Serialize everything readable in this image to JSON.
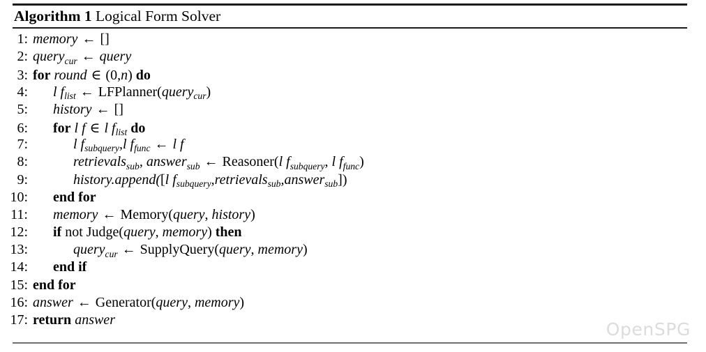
{
  "figure": {
    "kind": "algorithm-pseudocode",
    "title": {
      "keyword": "Algorithm",
      "number": "1",
      "caption": "Logical Form Solver"
    },
    "watermark": "OpenSPG",
    "rule_color": "#1a1a1a",
    "bottom_rule_color": "#6e6e6e",
    "watermark_color": "#dcdcdc"
  },
  "symbols": {
    "assign": "←",
    "member": "∈",
    "lbracket": "[",
    "rbracket": "]",
    "empty_list": "[]"
  },
  "lines": [
    {
      "n": "1:",
      "indent": 0,
      "plain": "memory ← []"
    },
    {
      "n": "2:",
      "indent": 0,
      "plain": "query_cur ← query"
    },
    {
      "n": "3:",
      "indent": 0,
      "plain": "for round ∈ (0,n) do"
    },
    {
      "n": "4:",
      "indent": 1,
      "plain": "lf_list ← LFPlanner(query_cur)"
    },
    {
      "n": "5:",
      "indent": 1,
      "plain": "history ← []"
    },
    {
      "n": "6:",
      "indent": 1,
      "plain": "for lf ∈ lf_list do"
    },
    {
      "n": "7:",
      "indent": 2,
      "plain": "lf_subquery, lf_func ← lf"
    },
    {
      "n": "8:",
      "indent": 2,
      "plain": "retrievals_sub, answer_sub ← Reasoner(lf_subquery, lf_func)"
    },
    {
      "n": "9:",
      "indent": 2,
      "plain": "history.append([lf_subquery, retrievals_sub, answer_sub])"
    },
    {
      "n": "10:",
      "indent": 1,
      "plain": "end for"
    },
    {
      "n": "11:",
      "indent": 1,
      "plain": "memory ← Memory(query, history)"
    },
    {
      "n": "12:",
      "indent": 1,
      "plain": "if not Judge(query, memory) then"
    },
    {
      "n": "13:",
      "indent": 2,
      "plain": "query_cur ← SupplyQuery(query, memory)"
    },
    {
      "n": "14:",
      "indent": 1,
      "plain": "end if"
    },
    {
      "n": "15:",
      "indent": 0,
      "plain": "end for"
    },
    {
      "n": "16:",
      "indent": 0,
      "plain": "answer ← Generator(query, memory)"
    },
    {
      "n": "17:",
      "indent": 0,
      "plain": "return answer"
    }
  ],
  "tokens": {
    "l1": [
      {
        "t": "memory",
        "s": "v"
      },
      {
        "t": " ← ",
        "s": "op"
      },
      {
        "t": "[]",
        "s": "f"
      }
    ],
    "l2": [
      {
        "t": "query",
        "s": "v",
        "sub": "cur"
      },
      {
        "t": " ← ",
        "s": "op"
      },
      {
        "t": "query",
        "s": "v"
      }
    ],
    "l3": [
      {
        "t": "for",
        "s": "b"
      },
      {
        "t": " ",
        "s": "f"
      },
      {
        "t": "round",
        "s": "v"
      },
      {
        "t": " ∈ ",
        "s": "op"
      },
      {
        "t": "(0,",
        "s": "f"
      },
      {
        "t": "n",
        "s": "v"
      },
      {
        "t": ") ",
        "s": "f"
      },
      {
        "t": "do",
        "s": "b"
      }
    ],
    "l4": [
      {
        "t": "l f",
        "s": "v",
        "sub": "list"
      },
      {
        "t": " ← ",
        "s": "op"
      },
      {
        "t": "LFPlanner(",
        "s": "f"
      },
      {
        "t": "query",
        "s": "v",
        "sub": "cur"
      },
      {
        "t": ")",
        "s": "f"
      }
    ],
    "l5": [
      {
        "t": "history",
        "s": "v"
      },
      {
        "t": " ← ",
        "s": "op"
      },
      {
        "t": "[]",
        "s": "f"
      }
    ],
    "l6": [
      {
        "t": "for",
        "s": "b"
      },
      {
        "t": " ",
        "s": "f"
      },
      {
        "t": "l f",
        "s": "v"
      },
      {
        "t": " ∈ ",
        "s": "op"
      },
      {
        "t": "l f",
        "s": "v",
        "sub": "list"
      },
      {
        "t": " ",
        "s": "f"
      },
      {
        "t": "do",
        "s": "b"
      }
    ],
    "l7": [
      {
        "t": "l f",
        "s": "v",
        "sub": "subquery"
      },
      {
        "t": ",",
        "s": "v"
      },
      {
        "t": "l f",
        "s": "v",
        "sub": "func"
      },
      {
        "t": " ← ",
        "s": "op"
      },
      {
        "t": "l f",
        "s": "v"
      }
    ],
    "l8": [
      {
        "t": "retrievals",
        "s": "v",
        "sub": "sub"
      },
      {
        "t": ", ",
        "s": "v"
      },
      {
        "t": "answer",
        "s": "v",
        "sub": "sub"
      },
      {
        "t": " ← ",
        "s": "op"
      },
      {
        "t": "Reasoner(",
        "s": "f"
      },
      {
        "t": "l f",
        "s": "v",
        "sub": "subquery"
      },
      {
        "t": ", ",
        "s": "f"
      },
      {
        "t": "l f",
        "s": "v",
        "sub": "func"
      },
      {
        "t": ")",
        "s": "f"
      }
    ],
    "l9": [
      {
        "t": "history.append(",
        "s": "v"
      },
      {
        "t": "[",
        "s": "f"
      },
      {
        "t": "l f",
        "s": "v",
        "sub": "subquery"
      },
      {
        "t": ",",
        "s": "v"
      },
      {
        "t": "retrievals",
        "s": "v",
        "sub": "sub"
      },
      {
        "t": ",",
        "s": "v"
      },
      {
        "t": "answer",
        "s": "v",
        "sub": "sub"
      },
      {
        "t": "]",
        "s": "f"
      },
      {
        "t": ")",
        "s": "f"
      }
    ],
    "l10": [
      {
        "t": "end for",
        "s": "b"
      }
    ],
    "l11": [
      {
        "t": "memory",
        "s": "v"
      },
      {
        "t": " ← ",
        "s": "op"
      },
      {
        "t": "Memory(",
        "s": "f"
      },
      {
        "t": "query",
        "s": "v"
      },
      {
        "t": ", ",
        "s": "f"
      },
      {
        "t": "history",
        "s": "v"
      },
      {
        "t": ")",
        "s": "f"
      }
    ],
    "l12": [
      {
        "t": "if",
        "s": "b"
      },
      {
        "t": " not Judge(",
        "s": "f"
      },
      {
        "t": "query",
        "s": "v"
      },
      {
        "t": ", ",
        "s": "f"
      },
      {
        "t": "memory",
        "s": "v"
      },
      {
        "t": ") ",
        "s": "f"
      },
      {
        "t": "then",
        "s": "b"
      }
    ],
    "l13": [
      {
        "t": "query",
        "s": "v",
        "sub": "cur"
      },
      {
        "t": " ← ",
        "s": "op"
      },
      {
        "t": "SupplyQuery(",
        "s": "f"
      },
      {
        "t": "query",
        "s": "v"
      },
      {
        "t": ", ",
        "s": "f"
      },
      {
        "t": "memory",
        "s": "v"
      },
      {
        "t": ")",
        "s": "f"
      }
    ],
    "l14": [
      {
        "t": "end if",
        "s": "b"
      }
    ],
    "l15": [
      {
        "t": "end for",
        "s": "b"
      }
    ],
    "l16": [
      {
        "t": "answer",
        "s": "v"
      },
      {
        "t": " ← ",
        "s": "op"
      },
      {
        "t": "Generator(",
        "s": "f"
      },
      {
        "t": "query",
        "s": "v"
      },
      {
        "t": ", ",
        "s": "f"
      },
      {
        "t": "memory",
        "s": "v"
      },
      {
        "t": ")",
        "s": "f"
      }
    ],
    "l17": [
      {
        "t": "return",
        "s": "b"
      },
      {
        "t": " ",
        "s": "f"
      },
      {
        "t": "answer",
        "s": "v"
      }
    ]
  }
}
